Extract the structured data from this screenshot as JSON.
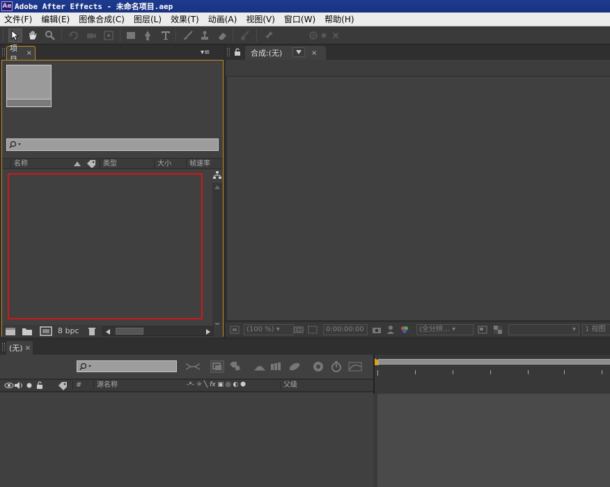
{
  "window": {
    "app_icon_text": "Ae",
    "title": "Adobe After Effects - 未命名项目.aep"
  },
  "menu": [
    "文件(F)",
    "编辑(E)",
    "图像合成(C)",
    "图层(L)",
    "效果(T)",
    "动画(A)",
    "视图(V)",
    "窗口(W)",
    "帮助(H)"
  ],
  "toolbar": {
    "tools": [
      "selection-tool",
      "hand-tool",
      "zoom-tool",
      "rotate-tool",
      "camera-orbit-tool",
      "pan-behind-tool",
      "rectangle-mask-tool",
      "pen-tool",
      "type-tool",
      "brush-tool",
      "clone-stamp-tool",
      "eraser-tool",
      "roto-brush-tool",
      "puppet-pin-tool"
    ],
    "active_tool": "selection-tool"
  },
  "project_panel": {
    "tab_label": "项目",
    "columns": [
      "名称",
      "类型",
      "大小",
      "帧速率"
    ],
    "bpc_label": "8 bpc"
  },
  "comp_panel": {
    "tab_label": "合成:(无)",
    "zoom": "(100 %)",
    "timecode": "0:00:00:00",
    "resolution": "(全分辨…",
    "views": "1 视图"
  },
  "timeline_panel": {
    "tab_label": "(无)",
    "columns": [
      "#",
      "源名称",
      "父级"
    ]
  },
  "colors": {
    "title_bar": "#1d3b8f",
    "panel_bg": "#404040",
    "project_frame": "#c08a1e",
    "highlight_box": "#d01717"
  }
}
